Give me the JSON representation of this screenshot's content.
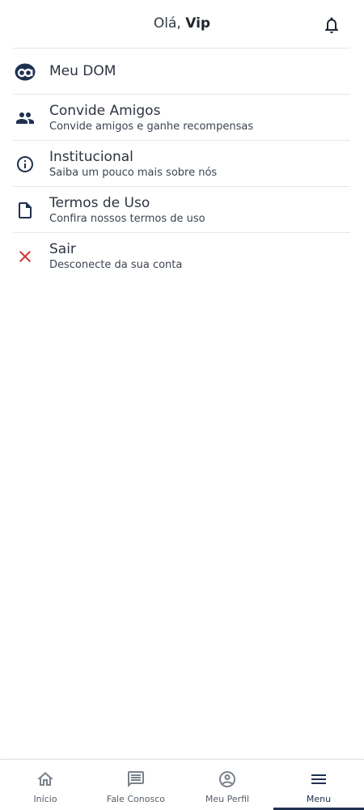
{
  "header": {
    "greeting_prefix": "Olá, ",
    "user_name": "Vip"
  },
  "menu": {
    "items": [
      {
        "title": "Meu DOM",
        "subtitle": "",
        "icon": "dom-logo-icon"
      },
      {
        "title": "Convide Amigos",
        "subtitle": "Convide amigos e ganhe recompensas",
        "icon": "people-icon"
      },
      {
        "title": "Institucional",
        "subtitle": "Saiba um pouco mais sobre nós",
        "icon": "info-icon"
      },
      {
        "title": "Termos de Uso",
        "subtitle": "Confira nossos termos de uso",
        "icon": "document-icon"
      },
      {
        "title": "Sair",
        "subtitle": "Desconecte da sua conta",
        "icon": "close-icon"
      }
    ]
  },
  "bottom_nav": {
    "tabs": [
      {
        "label": "Início",
        "icon": "home-icon"
      },
      {
        "label": "Fale Conosco",
        "icon": "chat-icon"
      },
      {
        "label": "Meu Perfil",
        "icon": "profile-icon"
      },
      {
        "label": "Menu",
        "icon": "hamburger-icon",
        "active": true
      }
    ]
  },
  "colors": {
    "brand_dark": "#1f3150",
    "logout_red": "#d32f2f",
    "text": "#2c3440"
  }
}
